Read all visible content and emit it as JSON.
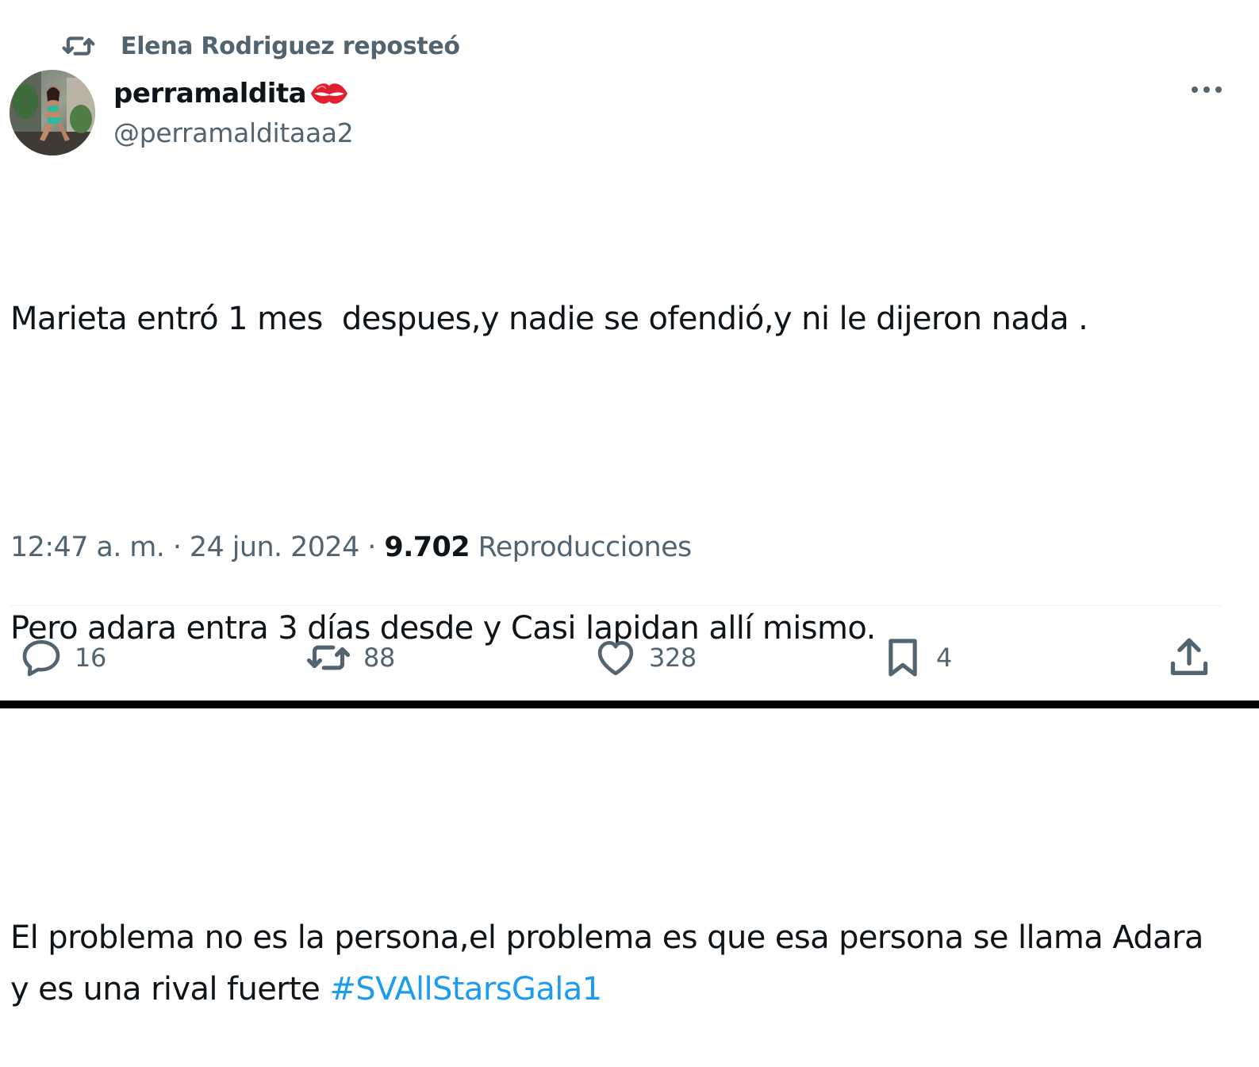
{
  "repost": {
    "icon": "repost-icon",
    "text": "Elena Rodriguez reposteó"
  },
  "author": {
    "display_name": "perramaldita",
    "name_emoji": "kiss-mark-icon",
    "handle": "@perramalditaaa2",
    "avatar": "avatar-photo"
  },
  "more_icon": "more-horizontal-icon",
  "tweet": {
    "paragraphs": [
      "Marieta entró 1 mes  despues,y nadie se ofendió,y ni le dijeron nada .",
      "Pero adara entra 3 días desde y Casi lapidan allí mismo."
    ],
    "last_paragraph_text": "El problema no es la persona,el problema es que esa persona se llama Adara y es una rival fuerte ",
    "hashtag": "#SVAllStarsGala1"
  },
  "meta": {
    "time": "12:47 a. m.",
    "separator": " · ",
    "date": "24 jun. 2024",
    "views_count": "9.702",
    "views_label": " Reproducciones"
  },
  "actions": {
    "reply": {
      "icon": "reply-icon",
      "count": "16"
    },
    "repost": {
      "icon": "repost-icon",
      "count": "88"
    },
    "like": {
      "icon": "heart-icon",
      "count": "328"
    },
    "bookmark": {
      "icon": "bookmark-icon",
      "count": "4"
    },
    "share": {
      "icon": "share-icon"
    }
  },
  "colors": {
    "text_primary": "#0f1419",
    "text_secondary": "#536471",
    "hashtag": "#1d9bf0",
    "emoji_red": "#e0202e"
  }
}
